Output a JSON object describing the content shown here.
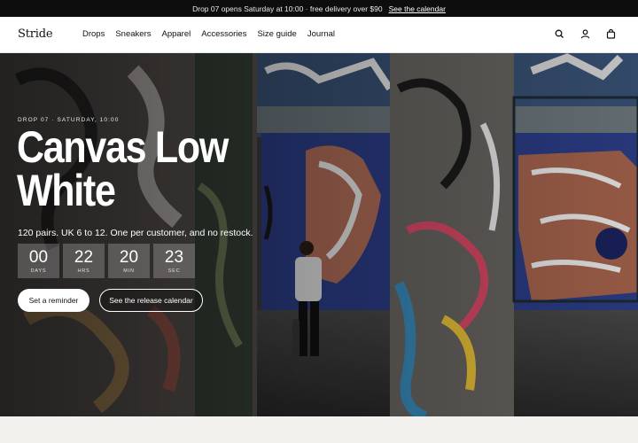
{
  "announcement": {
    "text": "Drop 07 opens Saturday at 10:00 · free delivery over $90",
    "link": "See the calendar"
  },
  "header": {
    "logo": "Stride",
    "nav": [
      "Drops",
      "Sneakers",
      "Apparel",
      "Accessories",
      "Size guide",
      "Journal"
    ],
    "icons": [
      "search-icon",
      "account-icon",
      "bag-icon"
    ]
  },
  "hero": {
    "eyebrow": "DROP 07 · SATURDAY, 10:00",
    "title_line1": "Canvas Low",
    "title_line2": "White",
    "subtitle": "120 pairs. UK 6 to 12. One per customer, and no restock.",
    "countdown": [
      {
        "value": "00",
        "label": "DAYS"
      },
      {
        "value": "22",
        "label": "HRS"
      },
      {
        "value": "20",
        "label": "MIN"
      },
      {
        "value": "23",
        "label": "SEC"
      }
    ],
    "primary_button": "Set a reminder",
    "secondary_button": "See the release calendar"
  },
  "colors": {
    "announce_bg": "#0d0d0d",
    "header_bg": "#ffffff",
    "button_bg": "#ffffff"
  }
}
